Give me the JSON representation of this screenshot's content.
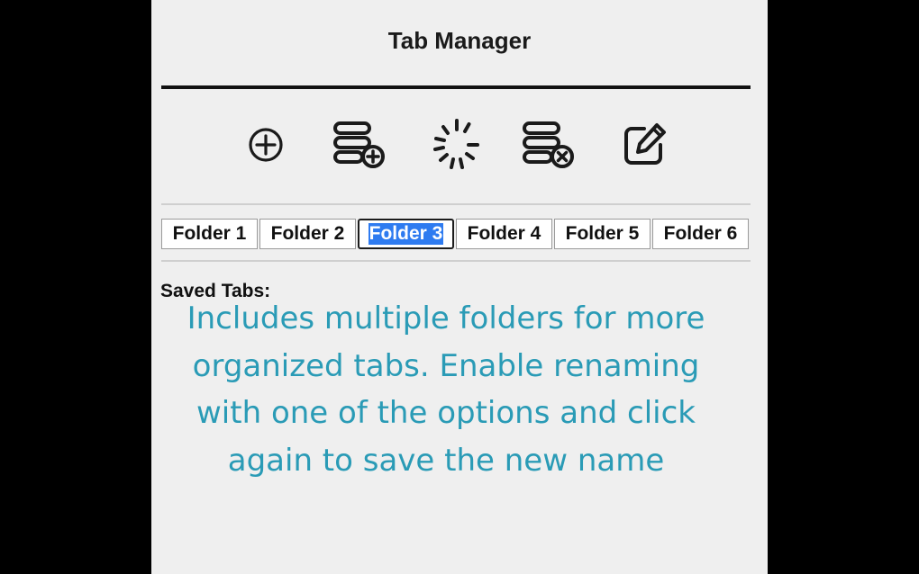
{
  "app": {
    "title": "Tab Manager"
  },
  "toolbar": {
    "buttons": [
      {
        "icon": "add-circle-icon"
      },
      {
        "icon": "save-tabs-icon"
      },
      {
        "icon": "loading-spinner-icon"
      },
      {
        "icon": "clear-tabs-icon"
      },
      {
        "icon": "edit-icon"
      }
    ]
  },
  "folders": {
    "tabs": [
      {
        "label": "Folder 1"
      },
      {
        "label": "Folder 2"
      },
      {
        "label": "Folder 3",
        "active": true
      },
      {
        "label": "Folder 4"
      },
      {
        "label": "Folder 5"
      },
      {
        "label": "Folder 6"
      }
    ]
  },
  "saved_tabs": {
    "label": "Saved Tabs:"
  },
  "caption": {
    "text": "Includes multiple folders for more organized tabs. Enable renaming with one of the options and click again to save the new name"
  },
  "colors": {
    "background": "#000000",
    "panel": "#efefef",
    "caption": "#2a9bb6",
    "selection": "#2e7bf0"
  }
}
